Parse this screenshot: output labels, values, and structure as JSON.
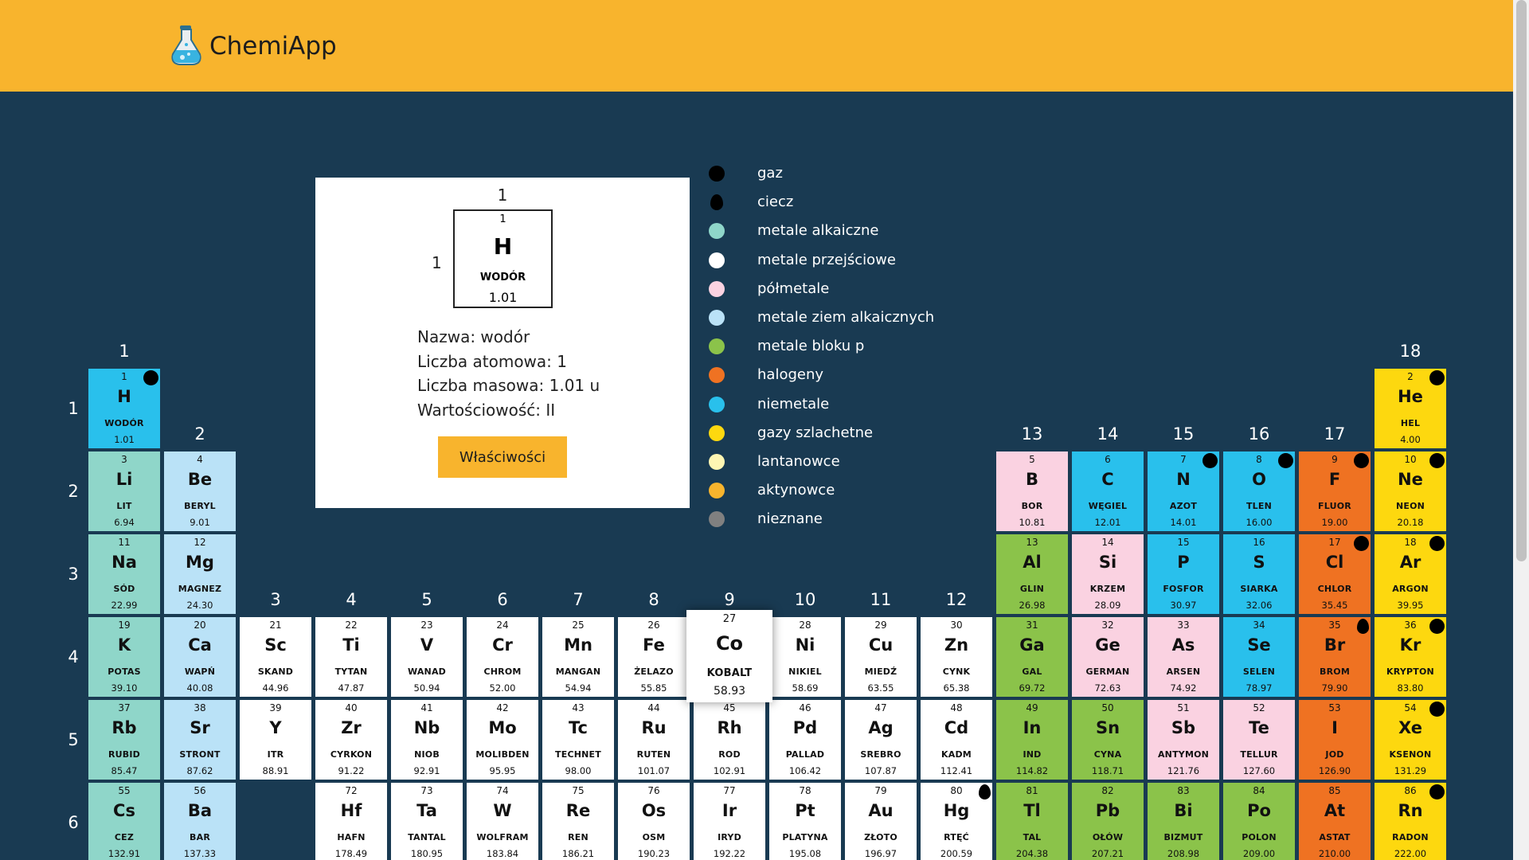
{
  "header": {
    "title": "ChemiApp",
    "logo_icon": "flask-icon",
    "background": "#f8b42d"
  },
  "group_labels": [
    "1",
    "2",
    "3",
    "4",
    "5",
    "6",
    "7",
    "8",
    "9",
    "10",
    "11",
    "12",
    "13",
    "14",
    "15",
    "16",
    "17",
    "18"
  ],
  "period_labels": [
    "1",
    "2",
    "3",
    "4",
    "5",
    "6"
  ],
  "selected_element": {
    "group": "1",
    "period": "1",
    "number": "1",
    "symbol": "H",
    "name": "WODÓR",
    "mass": "1.01",
    "lines": [
      "Nazwa: wodór",
      "Liczba atomowa: 1",
      "Liczba masowa: 1.01 u",
      "Wartościowość: II"
    ],
    "button_label": "Właściwości"
  },
  "legend": [
    {
      "label": "gaz",
      "color": "#000000",
      "icon": "gas-circle-icon"
    },
    {
      "label": "ciecz",
      "color": "#000000",
      "icon": "liquid-drop-icon"
    },
    {
      "label": "metale alkaiczne",
      "color": "#8fd6c9",
      "icon": "color-dot-icon"
    },
    {
      "label": "metale przejściowe",
      "color": "#ffffff",
      "icon": "color-dot-icon"
    },
    {
      "label": "półmetale",
      "color": "#fad2e1",
      "icon": "color-dot-icon"
    },
    {
      "label": "metale ziem alkaicznych",
      "color": "#bae2f7",
      "icon": "color-dot-icon"
    },
    {
      "label": "metale bloku p",
      "color": "#8bc34a",
      "icon": "color-dot-icon"
    },
    {
      "label": "halogeny",
      "color": "#ef7222",
      "icon": "color-dot-icon"
    },
    {
      "label": "niemetale",
      "color": "#29c0ec",
      "icon": "color-dot-icon"
    },
    {
      "label": "gazy szlachetne",
      "color": "#fdd80f",
      "icon": "color-dot-icon"
    },
    {
      "label": "lantanowce",
      "color": "#fef6b3",
      "icon": "color-dot-icon"
    },
    {
      "label": "aktynowce",
      "color": "#f8b42d",
      "icon": "color-dot-icon"
    },
    {
      "label": "nieznane",
      "color": "#808080",
      "icon": "color-dot-icon"
    }
  ],
  "category_colors": {
    "alkali": "#8fd6c9",
    "alkaline": "#bae2f7",
    "transition": "#ffffff",
    "metalloid": "#fad2e1",
    "pblock": "#8bc34a",
    "halogen": "#ef7222",
    "nonmetal": "#29c0ec",
    "noble": "#fdd80f"
  },
  "elements": [
    {
      "n": "1",
      "s": "H",
      "name": "WODÓR",
      "m": "1.01",
      "g": 1,
      "p": 1,
      "c": "nonmetal",
      "state": "gas"
    },
    {
      "n": "2",
      "s": "He",
      "name": "HEL",
      "m": "4.00",
      "g": 18,
      "p": 1,
      "c": "noble",
      "state": "gas"
    },
    {
      "n": "3",
      "s": "Li",
      "name": "LIT",
      "m": "6.94",
      "g": 1,
      "p": 2,
      "c": "alkali"
    },
    {
      "n": "4",
      "s": "Be",
      "name": "BERYL",
      "m": "9.01",
      "g": 2,
      "p": 2,
      "c": "alkaline"
    },
    {
      "n": "5",
      "s": "B",
      "name": "BOR",
      "m": "10.81",
      "g": 13,
      "p": 2,
      "c": "metalloid"
    },
    {
      "n": "6",
      "s": "C",
      "name": "WĘGIEL",
      "m": "12.01",
      "g": 14,
      "p": 2,
      "c": "nonmetal"
    },
    {
      "n": "7",
      "s": "N",
      "name": "AZOT",
      "m": "14.01",
      "g": 15,
      "p": 2,
      "c": "nonmetal",
      "state": "gas"
    },
    {
      "n": "8",
      "s": "O",
      "name": "TLEN",
      "m": "16.00",
      "g": 16,
      "p": 2,
      "c": "nonmetal",
      "state": "gas"
    },
    {
      "n": "9",
      "s": "F",
      "name": "FLUOR",
      "m": "19.00",
      "g": 17,
      "p": 2,
      "c": "halogen",
      "state": "gas"
    },
    {
      "n": "10",
      "s": "Ne",
      "name": "NEON",
      "m": "20.18",
      "g": 18,
      "p": 2,
      "c": "noble",
      "state": "gas"
    },
    {
      "n": "11",
      "s": "Na",
      "name": "SÓD",
      "m": "22.99",
      "g": 1,
      "p": 3,
      "c": "alkali"
    },
    {
      "n": "12",
      "s": "Mg",
      "name": "MAGNEZ",
      "m": "24.30",
      "g": 2,
      "p": 3,
      "c": "alkaline"
    },
    {
      "n": "13",
      "s": "Al",
      "name": "GLIN",
      "m": "26.98",
      "g": 13,
      "p": 3,
      "c": "pblock"
    },
    {
      "n": "14",
      "s": "Si",
      "name": "KRZEM",
      "m": "28.09",
      "g": 14,
      "p": 3,
      "c": "metalloid"
    },
    {
      "n": "15",
      "s": "P",
      "name": "FOSFOR",
      "m": "30.97",
      "g": 15,
      "p": 3,
      "c": "nonmetal"
    },
    {
      "n": "16",
      "s": "S",
      "name": "SIARKA",
      "m": "32.06",
      "g": 16,
      "p": 3,
      "c": "nonmetal"
    },
    {
      "n": "17",
      "s": "Cl",
      "name": "CHLOR",
      "m": "35.45",
      "g": 17,
      "p": 3,
      "c": "halogen",
      "state": "gas"
    },
    {
      "n": "18",
      "s": "Ar",
      "name": "ARGON",
      "m": "39.95",
      "g": 18,
      "p": 3,
      "c": "noble",
      "state": "gas"
    },
    {
      "n": "19",
      "s": "K",
      "name": "POTAS",
      "m": "39.10",
      "g": 1,
      "p": 4,
      "c": "alkali"
    },
    {
      "n": "20",
      "s": "Ca",
      "name": "WAPŃ",
      "m": "40.08",
      "g": 2,
      "p": 4,
      "c": "alkaline"
    },
    {
      "n": "21",
      "s": "Sc",
      "name": "SKAND",
      "m": "44.96",
      "g": 3,
      "p": 4,
      "c": "transition"
    },
    {
      "n": "22",
      "s": "Ti",
      "name": "TYTAN",
      "m": "47.87",
      "g": 4,
      "p": 4,
      "c": "transition"
    },
    {
      "n": "23",
      "s": "V",
      "name": "WANAD",
      "m": "50.94",
      "g": 5,
      "p": 4,
      "c": "transition"
    },
    {
      "n": "24",
      "s": "Cr",
      "name": "CHROM",
      "m": "52.00",
      "g": 6,
      "p": 4,
      "c": "transition"
    },
    {
      "n": "25",
      "s": "Mn",
      "name": "MANGAN",
      "m": "54.94",
      "g": 7,
      "p": 4,
      "c": "transition"
    },
    {
      "n": "26",
      "s": "Fe",
      "name": "ŻELAZO",
      "m": "55.85",
      "g": 8,
      "p": 4,
      "c": "transition"
    },
    {
      "n": "27",
      "s": "Co",
      "name": "KOBALT",
      "m": "58.93",
      "g": 9,
      "p": 4,
      "c": "transition",
      "selected": true
    },
    {
      "n": "28",
      "s": "Ni",
      "name": "NIKIEL",
      "m": "58.69",
      "g": 10,
      "p": 4,
      "c": "transition"
    },
    {
      "n": "29",
      "s": "Cu",
      "name": "MIEDŹ",
      "m": "63.55",
      "g": 11,
      "p": 4,
      "c": "transition"
    },
    {
      "n": "30",
      "s": "Zn",
      "name": "CYNK",
      "m": "65.38",
      "g": 12,
      "p": 4,
      "c": "transition"
    },
    {
      "n": "31",
      "s": "Ga",
      "name": "GAL",
      "m": "69.72",
      "g": 13,
      "p": 4,
      "c": "pblock"
    },
    {
      "n": "32",
      "s": "Ge",
      "name": "GERMAN",
      "m": "72.63",
      "g": 14,
      "p": 4,
      "c": "metalloid"
    },
    {
      "n": "33",
      "s": "As",
      "name": "ARSEN",
      "m": "74.92",
      "g": 15,
      "p": 4,
      "c": "metalloid"
    },
    {
      "n": "34",
      "s": "Se",
      "name": "SELEN",
      "m": "78.97",
      "g": 16,
      "p": 4,
      "c": "nonmetal"
    },
    {
      "n": "35",
      "s": "Br",
      "name": "BROM",
      "m": "79.90",
      "g": 17,
      "p": 4,
      "c": "halogen",
      "state": "liquid"
    },
    {
      "n": "36",
      "s": "Kr",
      "name": "KRYPTON",
      "m": "83.80",
      "g": 18,
      "p": 4,
      "c": "noble",
      "state": "gas"
    },
    {
      "n": "37",
      "s": "Rb",
      "name": "RUBID",
      "m": "85.47",
      "g": 1,
      "p": 5,
      "c": "alkali"
    },
    {
      "n": "38",
      "s": "Sr",
      "name": "STRONT",
      "m": "87.62",
      "g": 2,
      "p": 5,
      "c": "alkaline"
    },
    {
      "n": "39",
      "s": "Y",
      "name": "ITR",
      "m": "88.91",
      "g": 3,
      "p": 5,
      "c": "transition"
    },
    {
      "n": "40",
      "s": "Zr",
      "name": "CYRKON",
      "m": "91.22",
      "g": 4,
      "p": 5,
      "c": "transition"
    },
    {
      "n": "41",
      "s": "Nb",
      "name": "NIOB",
      "m": "92.91",
      "g": 5,
      "p": 5,
      "c": "transition"
    },
    {
      "n": "42",
      "s": "Mo",
      "name": "MOLIBDEN",
      "m": "95.95",
      "g": 6,
      "p": 5,
      "c": "transition"
    },
    {
      "n": "43",
      "s": "Tc",
      "name": "TECHNET",
      "m": "98.00",
      "g": 7,
      "p": 5,
      "c": "transition"
    },
    {
      "n": "44",
      "s": "Ru",
      "name": "RUTEN",
      "m": "101.07",
      "g": 8,
      "p": 5,
      "c": "transition"
    },
    {
      "n": "45",
      "s": "Rh",
      "name": "ROD",
      "m": "102.91",
      "g": 9,
      "p": 5,
      "c": "transition"
    },
    {
      "n": "46",
      "s": "Pd",
      "name": "PALLAD",
      "m": "106.42",
      "g": 10,
      "p": 5,
      "c": "transition"
    },
    {
      "n": "47",
      "s": "Ag",
      "name": "SREBRO",
      "m": "107.87",
      "g": 11,
      "p": 5,
      "c": "transition"
    },
    {
      "n": "48",
      "s": "Cd",
      "name": "KADM",
      "m": "112.41",
      "g": 12,
      "p": 5,
      "c": "transition"
    },
    {
      "n": "49",
      "s": "In",
      "name": "IND",
      "m": "114.82",
      "g": 13,
      "p": 5,
      "c": "pblock"
    },
    {
      "n": "50",
      "s": "Sn",
      "name": "CYNA",
      "m": "118.71",
      "g": 14,
      "p": 5,
      "c": "pblock"
    },
    {
      "n": "51",
      "s": "Sb",
      "name": "ANTYMON",
      "m": "121.76",
      "g": 15,
      "p": 5,
      "c": "metalloid"
    },
    {
      "n": "52",
      "s": "Te",
      "name": "TELLUR",
      "m": "127.60",
      "g": 16,
      "p": 5,
      "c": "metalloid"
    },
    {
      "n": "53",
      "s": "I",
      "name": "JOD",
      "m": "126.90",
      "g": 17,
      "p": 5,
      "c": "halogen"
    },
    {
      "n": "54",
      "s": "Xe",
      "name": "KSENON",
      "m": "131.29",
      "g": 18,
      "p": 5,
      "c": "noble",
      "state": "gas"
    },
    {
      "n": "55",
      "s": "Cs",
      "name": "CEZ",
      "m": "132.91",
      "g": 1,
      "p": 6,
      "c": "alkali"
    },
    {
      "n": "56",
      "s": "Ba",
      "name": "BAR",
      "m": "137.33",
      "g": 2,
      "p": 6,
      "c": "alkaline"
    },
    {
      "n": "72",
      "s": "Hf",
      "name": "HAFN",
      "m": "178.49",
      "g": 4,
      "p": 6,
      "c": "transition"
    },
    {
      "n": "73",
      "s": "Ta",
      "name": "TANTAL",
      "m": "180.95",
      "g": 5,
      "p": 6,
      "c": "transition"
    },
    {
      "n": "74",
      "s": "W",
      "name": "WOLFRAM",
      "m": "183.84",
      "g": 6,
      "p": 6,
      "c": "transition"
    },
    {
      "n": "75",
      "s": "Re",
      "name": "REN",
      "m": "186.21",
      "g": 7,
      "p": 6,
      "c": "transition"
    },
    {
      "n": "76",
      "s": "Os",
      "name": "OSM",
      "m": "190.23",
      "g": 8,
      "p": 6,
      "c": "transition"
    },
    {
      "n": "77",
      "s": "Ir",
      "name": "IRYD",
      "m": "192.22",
      "g": 9,
      "p": 6,
      "c": "transition"
    },
    {
      "n": "78",
      "s": "Pt",
      "name": "PLATYNA",
      "m": "195.08",
      "g": 10,
      "p": 6,
      "c": "transition"
    },
    {
      "n": "79",
      "s": "Au",
      "name": "ZŁOTO",
      "m": "196.97",
      "g": 11,
      "p": 6,
      "c": "transition"
    },
    {
      "n": "80",
      "s": "Hg",
      "name": "RTĘĆ",
      "m": "200.59",
      "g": 12,
      "p": 6,
      "c": "transition",
      "state": "liquid"
    },
    {
      "n": "81",
      "s": "Tl",
      "name": "TAL",
      "m": "204.38",
      "g": 13,
      "p": 6,
      "c": "pblock"
    },
    {
      "n": "82",
      "s": "Pb",
      "name": "OŁÓW",
      "m": "207.21",
      "g": 14,
      "p": 6,
      "c": "pblock"
    },
    {
      "n": "83",
      "s": "Bi",
      "name": "BIZMUT",
      "m": "208.98",
      "g": 15,
      "p": 6,
      "c": "pblock"
    },
    {
      "n": "84",
      "s": "Po",
      "name": "POLON",
      "m": "209.00",
      "g": 16,
      "p": 6,
      "c": "pblock"
    },
    {
      "n": "85",
      "s": "At",
      "name": "ASTAT",
      "m": "210.00",
      "g": 17,
      "p": 6,
      "c": "halogen"
    },
    {
      "n": "86",
      "s": "Rn",
      "name": "RADON",
      "m": "222.00",
      "g": 18,
      "p": 6,
      "c": "noble",
      "state": "gas"
    }
  ]
}
